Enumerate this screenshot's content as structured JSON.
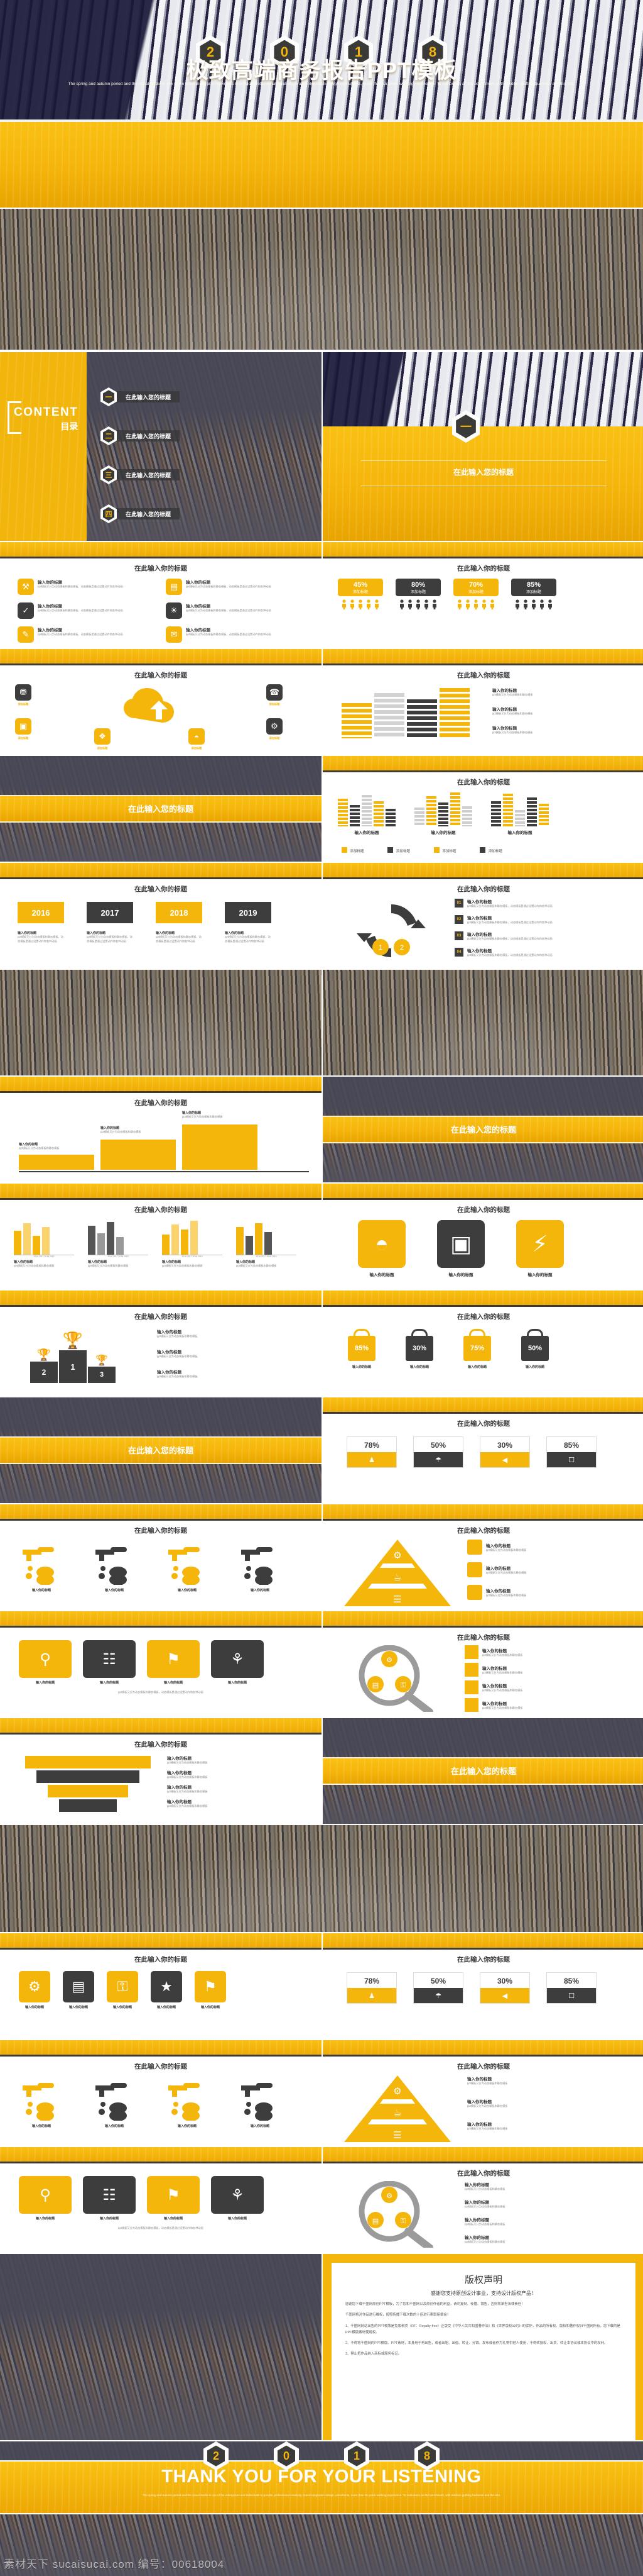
{
  "meta": {
    "accent_yellow": "#F5B40A",
    "accent_dark": "#3B3A38",
    "navy": "#1A1937",
    "white": "#FFFFFF"
  },
  "cover": {
    "year_digits": [
      "2",
      "0",
      "1",
      "8"
    ],
    "title": "极致高端商务报告PPT模板",
    "subtitle": "The spring and autumn period and the visual studio is one of the enterprises and individuals to provide professional creativity, brand integration design consultants, more than 15 years working experience. To customers as the benchmark, with wisdom grafting business and the arts."
  },
  "toc": {
    "brand_en": "CONTENT",
    "brand_cn": "目录",
    "items": [
      {
        "num": "一",
        "label": "在此输入您的标题"
      },
      {
        "num": "二",
        "label": "在此输入您的标题"
      },
      {
        "num": "三",
        "label": "在此输入您的标题"
      },
      {
        "num": "四",
        "label": "在此输入您的标题"
      }
    ],
    "section_badge": "一",
    "section_title": "在此输入您的标题"
  },
  "common": {
    "slide_title": "在此输入你的标题",
    "band_title": "在此输入您的标题",
    "item_title": "输入你的标题",
    "item_body": "ppt模板又分为动态模板和静态模板，动态模板是通过设置动作和各种动画",
    "add_title": "添加标题",
    "input_title": "输入的标题"
  },
  "slide_icon_grid": {
    "title": "在此输入你的标题",
    "items": [
      {
        "icon": "wrench-icon",
        "glyph": "⚒",
        "tone": "yellow",
        "title": "输入你的标题",
        "body": "ppt模板又分为动态模板和静态模板，动态模板是通过设置动作和各种动画"
      },
      {
        "icon": "bar-chart-icon",
        "glyph": "▤",
        "tone": "yellow",
        "title": "输入你的标题",
        "body": "ppt模板又分为动态模板和静态模板，动态模板是通过设置动作和各种动画"
      },
      {
        "icon": "check-icon",
        "glyph": "✓",
        "tone": "dark",
        "title": "输入你的标题",
        "body": "ppt模板又分为动态模板和静态模板，动态模板是通过设置动作和各种动画"
      },
      {
        "icon": "lightbulb-icon",
        "glyph": "☀",
        "tone": "dark",
        "title": "输入你的标题",
        "body": "ppt模板又分为动态模板和静态模板，动态模板是通过设置动作和各种动画"
      },
      {
        "icon": "pencil-icon",
        "glyph": "✎",
        "tone": "yellow",
        "title": "输入你的标题",
        "body": "ppt模板又分为动态模板和静态模板，动态模板是通过设置动作和各种动画"
      },
      {
        "icon": "chat-icon",
        "glyph": "✉",
        "tone": "yellow",
        "title": "输入你的标题",
        "body": "ppt模板又分为动态模板和静态模板，动态模板是通过设置动作和各种动画"
      }
    ]
  },
  "slide_people": {
    "title": "在此输入你的标题",
    "groups": [
      {
        "pct": "45%",
        "label": "添加标题",
        "tone": "yellow",
        "people": 5
      },
      {
        "pct": "80%",
        "label": "添加标题",
        "tone": "dark",
        "people": 5
      },
      {
        "pct": "70%",
        "label": "添加标题",
        "tone": "yellow",
        "people": 5
      },
      {
        "pct": "85%",
        "label": "添加标题",
        "tone": "dark",
        "people": 5
      }
    ]
  },
  "slide_cloud": {
    "title": "在此输入你的标题",
    "center_icon": "cloud-upload-icon",
    "nodes": [
      {
        "icon": "cart-icon",
        "glyph": "⛟",
        "label": "添加标题",
        "tone": "dark"
      },
      {
        "icon": "mobile-icon",
        "glyph": "☎",
        "label": "添加标题",
        "tone": "dark"
      },
      {
        "icon": "monitor-icon",
        "glyph": "▣",
        "label": "添加标题",
        "tone": "dark"
      },
      {
        "icon": "wifi-icon",
        "glyph": "◔",
        "label": "添加标题",
        "tone": "dark"
      },
      {
        "icon": "cube-icon",
        "glyph": "❖",
        "label": "添加标题",
        "tone": "yellow"
      },
      {
        "icon": "gear-icon",
        "glyph": "⚙",
        "label": "添加标题",
        "tone": "yellow"
      }
    ]
  },
  "slide_buildings": {
    "title": "在此输入你的标题",
    "items": [
      {
        "tone": "yellow",
        "label": "输入你的标题",
        "body": "ppt模板又分为动态模板和静态模板"
      },
      {
        "tone": "grey",
        "label": "输入你的标题",
        "body": "ppt模板又分为动态模板和静态模板"
      },
      {
        "tone": "dark",
        "label": "输入你的标题",
        "body": "ppt模板又分为动态模板和静态模板"
      },
      {
        "tone": "yellow",
        "label": "输入你的标题",
        "body": "ppt模板又分为动态模板和静态模板"
      }
    ]
  },
  "slide_columns": {
    "title": "在此输入你的标题",
    "columns": [
      {
        "label": "输入你的标题"
      },
      {
        "label": "输入你的标题"
      },
      {
        "label": "输入你的标题"
      }
    ],
    "legend": [
      {
        "tone": "yellow",
        "label": "添加标题"
      },
      {
        "tone": "dark",
        "label": "添加标题"
      },
      {
        "tone": "yellow",
        "label": "添加标题"
      },
      {
        "tone": "dark",
        "label": "添加标题"
      }
    ]
  },
  "slide_years": {
    "title": "在此输入你的标题",
    "years": [
      {
        "year": "2016",
        "tone": "yellow",
        "label": "输入你的标题"
      },
      {
        "year": "2017",
        "tone": "dark",
        "label": "输入你的标题"
      },
      {
        "year": "2018",
        "tone": "yellow",
        "label": "输入你的标题"
      },
      {
        "year": "2019",
        "tone": "dark",
        "label": "输入你的标题"
      }
    ]
  },
  "slide_cycle": {
    "title": "在此输入你的标题",
    "steps": [
      {
        "num": "01",
        "label": "输入你的标题"
      },
      {
        "num": "02",
        "label": "输入你的标题"
      },
      {
        "num": "03",
        "label": "输入你的标题"
      },
      {
        "num": "04",
        "label": "输入你的标题"
      }
    ],
    "ring_numbers": [
      "1",
      "2"
    ]
  },
  "slide_stairs": {
    "title": "在此输入你的标题",
    "steps": [
      {
        "label": "输入你的标题",
        "body": "ppt模板又分为动态模板和静态模板"
      },
      {
        "label": "输入你的标题",
        "body": "ppt模板又分为动态模板和静态模板"
      },
      {
        "label": "输入你的标题",
        "body": "ppt模板又分为动态模板和静态模板"
      }
    ]
  },
  "slide_bars": {
    "title": "在此输入你的标题",
    "groups": [
      {
        "label": "输入你的标题",
        "body": "ppt模板又分为动态模板和静态模板"
      },
      {
        "label": "输入你的标题",
        "body": "ppt模板又分为动态模板和静态模板"
      },
      {
        "label": "输入你的标题",
        "body": "ppt模板又分为动态模板和静态模板"
      },
      {
        "label": "输入你的标题",
        "body": "ppt模板又分为动态模板和静态模板"
      }
    ]
  },
  "slide_bigicons": {
    "title": "在此输入你的标题",
    "items": [
      {
        "icon": "compass-icon",
        "glyph": "◔",
        "tone": "yellow",
        "label": "输入你的标题"
      },
      {
        "icon": "monitor-icon",
        "glyph": "▣",
        "tone": "dark",
        "label": "输入你的标题"
      },
      {
        "icon": "plug-icon",
        "glyph": "⚡",
        "tone": "yellow",
        "label": "输入你的标题"
      }
    ]
  },
  "slide_podium": {
    "title": "在此输入你的标题",
    "places": [
      {
        "rank": "2",
        "icon": "trophy-icon"
      },
      {
        "rank": "1",
        "icon": "trophy-icon"
      },
      {
        "rank": "3",
        "icon": "trophy-icon"
      }
    ],
    "labels": [
      {
        "label": "输入你的标题",
        "body": "ppt模板又分为动态模板和静态模板"
      },
      {
        "label": "输入你的标题",
        "body": "ppt模板又分为动态模板和静态模板"
      },
      {
        "label": "输入你的标题",
        "body": "ppt模板又分为动态模板和静态模板"
      }
    ]
  },
  "slide_bags": {
    "title": "在此输入你的标题",
    "bags": [
      {
        "pct": "85%",
        "tone": "yellow",
        "label": "输入你的标题"
      },
      {
        "pct": "30%",
        "tone": "dark",
        "label": "输入你的标题"
      },
      {
        "pct": "75%",
        "tone": "yellow",
        "label": "输入你的标题"
      },
      {
        "pct": "50%",
        "tone": "dark",
        "label": "输入你的标题"
      }
    ]
  },
  "slide_stats": {
    "title": "在此输入你的标题",
    "cards": [
      {
        "pct": "78%",
        "tone": "yellow",
        "icon": "user-icon",
        "glyph": "♟"
      },
      {
        "pct": "50%",
        "tone": "dark",
        "icon": "umbrella-icon",
        "glyph": "☂"
      },
      {
        "pct": "30%",
        "tone": "yellow",
        "icon": "megaphone-icon",
        "glyph": "◀"
      },
      {
        "pct": "85%",
        "tone": "dark",
        "icon": "mobile-icon",
        "glyph": "☐"
      }
    ]
  },
  "slide_funnel": {
    "title": "在此输入你的标题",
    "rows": [
      {
        "label": "输入你的标题",
        "body": "ppt模板又分为动态模板和静态模板"
      },
      {
        "label": "输入你的标题",
        "body": "ppt模板又分为动态模板和静态模板"
      },
      {
        "label": "输入你的标题",
        "body": "ppt模板又分为动态模板和静态模板"
      },
      {
        "label": "输入你的标题",
        "body": "ppt模板又分为动态模板和静态模板"
      }
    ]
  },
  "slide_taps": {
    "title": "在此输入你的标题",
    "taps": [
      {
        "tone": "yellow",
        "label": "输入你的标题"
      },
      {
        "tone": "dark",
        "label": "输入你的标题"
      },
      {
        "tone": "yellow",
        "label": "输入你的标题"
      },
      {
        "tone": "dark",
        "label": "输入你的标题"
      }
    ]
  },
  "slide_triangle": {
    "title": "在此输入你的标题",
    "levels": [
      {
        "icon": "gear-icon",
        "glyph": "⚙"
      },
      {
        "icon": "cup-icon",
        "glyph": "☕"
      },
      {
        "icon": "book-icon",
        "glyph": "☰"
      }
    ],
    "rows": [
      {
        "label": "输入你的标题",
        "body": "ppt模板又分为动态模板和静态模板"
      },
      {
        "label": "输入你的标题",
        "body": "ppt模板又分为动态模板和静态模板"
      },
      {
        "label": "输入你的标题",
        "body": "ppt模板又分为动态模板和静态模板"
      }
    ]
  },
  "slide_cards4": {
    "title": "在此输入你的标题",
    "cards": [
      {
        "icon": "search-doc-icon",
        "glyph": "⚲",
        "tone": "yellow",
        "label": "输入你的标题"
      },
      {
        "icon": "clipboard-icon",
        "glyph": "☷",
        "tone": "dark",
        "label": "输入你的标题"
      },
      {
        "icon": "target-icon",
        "glyph": "⚑",
        "tone": "yellow",
        "label": "输入你的标题"
      },
      {
        "icon": "plant-icon",
        "glyph": "⚘",
        "tone": "dark",
        "label": "输入你的标题"
      }
    ],
    "footer": "ppt模板又分为动态模板和静态模板，动态模板是通过设置动作和各种动画"
  },
  "slide_magnifier": {
    "title": "在此输入你的标题",
    "center_icon": "magnifier-icon",
    "inner": [
      {
        "icon": "gear-icon",
        "glyph": "⚙"
      },
      {
        "icon": "chart-icon",
        "glyph": "▤"
      },
      {
        "icon": "lock-icon",
        "glyph": "⚿"
      }
    ],
    "rows": [
      {
        "label": "输入你的标题",
        "body": "ppt模板又分为动态模板和静态模板"
      },
      {
        "label": "输入你的标题",
        "body": "ppt模板又分为动态模板和静态模板"
      },
      {
        "label": "输入你的标题",
        "body": "ppt模板又分为动态模板和静态模板"
      },
      {
        "label": "输入你的标题",
        "body": "ppt模板又分为动态模板和静态模板"
      }
    ]
  },
  "thanks": {
    "year_digits": [
      "2",
      "0",
      "1",
      "8"
    ],
    "title": "THANK YOU FOR YOUR LISTENING",
    "subtitle": "The spring and autumn period and the visual studio is one of the enterprises and individuals to provide professional creativity, brand integration design consultants, more than 15 years working experience. To customers as the benchmark, with wisdom grafting business and the arts."
  },
  "copyright": {
    "title": "版权声明",
    "subtitle": "感谢您支持原创设计事业，支持设计版权产品！",
    "paragraphs": [
      "感谢您下载千图网原创PPT模板，为了您和千图网以及原创作者的利益，请勿复制、传播、销售，否则将承担法律责任！",
      "千图网将对作品进行维权，按照传播下载次数的十倍进行索取赔偿金！",
      "1、千图网网站出售的PPT模版是免版税类（RF：Royalty-free）正版受《中华人民共和国著作法》和《世界版权公约》的保护，作品的所有权、版权和著作权归千图网所有，您下载的是PPT模版素材使用权。",
      "2、不得将千图网的PPT模版、PPT素材，本身用于再出售，或者出租、出借、转让、分销、发布或者作为礼物供他人使用，不得转授权、出卖、转让本协议或本协议中的权利。",
      "3、禁止把作品纳入商标或服务标记。"
    ]
  },
  "watermark": {
    "text": "素材天下 sucaisucai.com  编号：00618004"
  }
}
